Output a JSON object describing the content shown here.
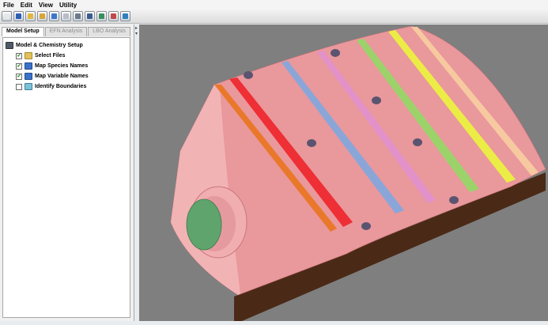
{
  "menu": [
    "File",
    "Edit",
    "View",
    "Utility"
  ],
  "toolbar": [
    {
      "icon": "new-icon",
      "color": "#e8e8e8"
    },
    {
      "icon": "save-icon",
      "color": "#2d5fb4"
    },
    {
      "icon": "open-icon",
      "color": "#e3b73e"
    },
    {
      "icon": "folder-icon",
      "color": "#d9a534"
    },
    {
      "icon": "import-icon",
      "color": "#3f75c7"
    },
    {
      "icon": "disabled-icon",
      "color": "#b9bec4"
    },
    {
      "icon": "settings-icon",
      "color": "#6e7a8a"
    },
    {
      "icon": "grid-icon",
      "color": "#3a5c8a"
    },
    {
      "icon": "model-icon",
      "color": "#3c8d5a"
    },
    {
      "icon": "chart-icon",
      "color": "#c04848"
    },
    {
      "icon": "refresh-icon",
      "color": "#2f7fbf"
    }
  ],
  "tabs": [
    "Model Setup",
    "EFN Analysis",
    "LBO Analysis"
  ],
  "tree": {
    "root": "Model & Chemistry Setup",
    "items": [
      {
        "label": "Select Files",
        "checked": true,
        "icon": "folder-icon"
      },
      {
        "label": "Map Species Names",
        "checked": true,
        "icon": "map-icon"
      },
      {
        "label": "Map Variable Names",
        "checked": true,
        "icon": "map-icon"
      },
      {
        "label": "Identify Boundaries",
        "checked": false,
        "icon": "boundary-icon"
      }
    ]
  },
  "colors": {
    "body": "#e9989c",
    "base": "#4a2a16",
    "inlet": "#5fa46c",
    "zones": [
      "#e9782b",
      "#ee2f35",
      "#8aa6d8",
      "#e291c9",
      "#9bd36a",
      "#ecec46",
      "#f7c9a0"
    ]
  }
}
